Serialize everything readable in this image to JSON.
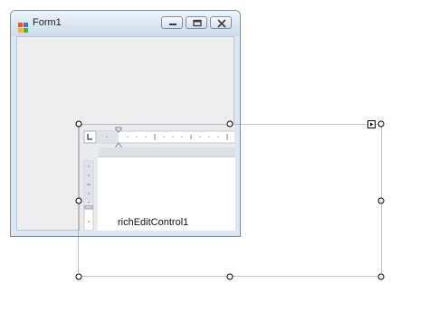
{
  "window": {
    "title": "Form1"
  },
  "title_buttons": {
    "minimize": "minimize-icon",
    "maximize": "maximize-icon",
    "close": "close-icon"
  },
  "control": {
    "name": "richEditControl1",
    "tab_stop_icon": "tab-left-icon",
    "smart_tag_icon": "smart-tag-arrow-icon"
  }
}
